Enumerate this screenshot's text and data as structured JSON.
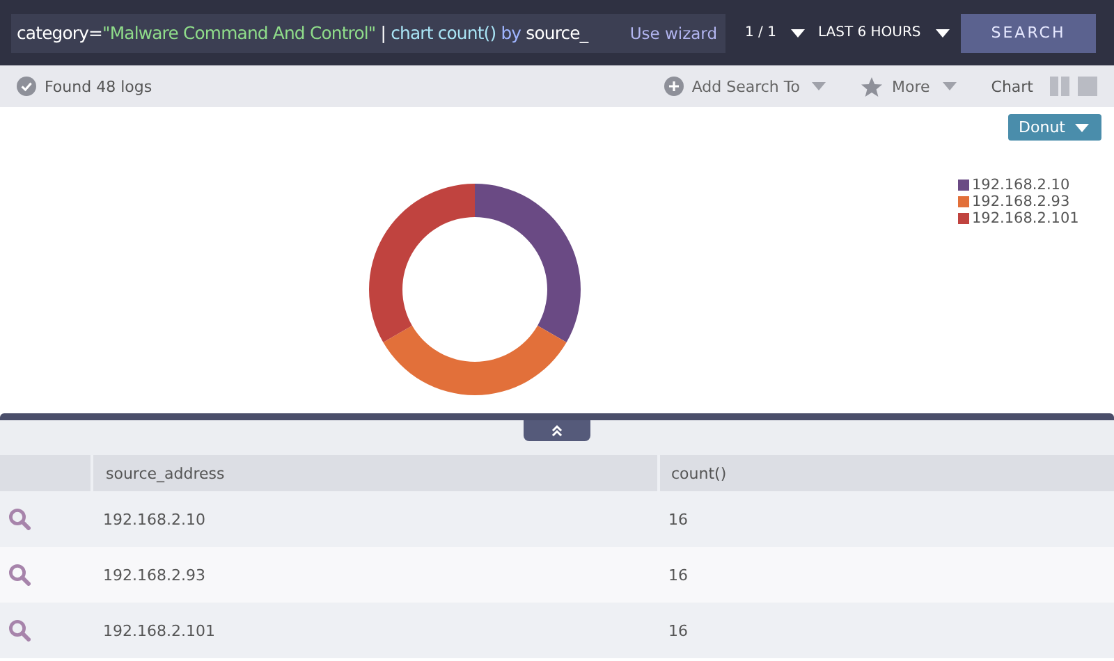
{
  "query": {
    "segments": [
      {
        "kind": "plain",
        "text": "category="
      },
      {
        "kind": "string",
        "text": "\"Malware Command And Control\""
      },
      {
        "kind": "plain",
        "text": " | "
      },
      {
        "kind": "command",
        "text": "chart count()"
      },
      {
        "kind": "keyword",
        "text": " by "
      },
      {
        "kind": "plain",
        "text": "source_"
      }
    ],
    "wizard_link": "Use wizard"
  },
  "pager": "1 / 1",
  "time_range": "LAST 6 HOURS",
  "search_button": "SEARCH",
  "toolbar": {
    "status": "Found 48 logs",
    "add_search": "Add Search To",
    "more": "More",
    "chart_label": "Chart"
  },
  "chart_type_button": "Donut",
  "chart_data": {
    "type": "donut",
    "categories": [
      "192.168.2.10",
      "192.168.2.93",
      "192.168.2.101"
    ],
    "values": [
      33.33,
      33.33,
      33.34
    ],
    "colors": [
      "#6a4a84",
      "#e2703a",
      "#c0433f"
    ]
  },
  "table": {
    "columns": [
      "source_address",
      "count()"
    ],
    "rows": [
      [
        "192.168.2.10",
        "16"
      ],
      [
        "192.168.2.93",
        "16"
      ],
      [
        "192.168.2.101",
        "16"
      ]
    ]
  }
}
